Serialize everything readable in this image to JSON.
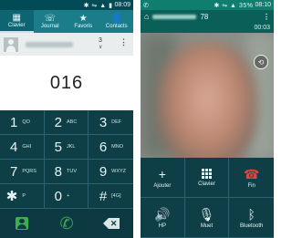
{
  "dialer": {
    "status": {
      "time": "08:09",
      "icons": "✱ ⇋ ▲ ▮"
    },
    "tabs": [
      {
        "label": "Clavier",
        "icon": "keypad-icon",
        "glyph": "▦"
      },
      {
        "label": "Journal",
        "icon": "call-log-icon",
        "glyph": "☏"
      },
      {
        "label": "Favoris",
        "icon": "star-icon",
        "glyph": "★"
      },
      {
        "label": "Contacts",
        "icon": "person-icon",
        "glyph": "👤"
      }
    ],
    "suggestion": {
      "count": "3",
      "chevron": "∨",
      "menu": "⋮"
    },
    "number": "016",
    "keys": [
      {
        "digit": "1",
        "sub": "QO"
      },
      {
        "digit": "2",
        "sub": "ABC"
      },
      {
        "digit": "3",
        "sub": "DEF"
      },
      {
        "digit": "4",
        "sub": "GHI"
      },
      {
        "digit": "5",
        "sub": "JKL"
      },
      {
        "digit": "6",
        "sub": "MNO"
      },
      {
        "digit": "7",
        "sub": "PQRS"
      },
      {
        "digit": "8",
        "sub": "TUV"
      },
      {
        "digit": "9",
        "sub": "WXYZ"
      },
      {
        "digit": "✱",
        "sub": "P"
      },
      {
        "digit": "0",
        "sub": "+"
      },
      {
        "digit": "#",
        "sub": "[4G]"
      }
    ],
    "actions": {
      "contact_icon": "add-contact-icon",
      "call_icon": "phone-icon",
      "call_glyph": "✆",
      "delete_icon": "backspace-icon",
      "delete_glyph": "✕"
    },
    "colors": {
      "accent": "#1b7d8a",
      "call_green": "#3cae50"
    }
  },
  "call": {
    "status": {
      "time": "08:10",
      "signal": "35%",
      "icons": "✱ ⇋ ▲"
    },
    "header": {
      "home_glyph": "⌂",
      "number_suffix": "78",
      "menu": "⋮",
      "timer": "00:03"
    },
    "swap_glyph": "⟲",
    "buttons": [
      {
        "label": "Ajouter",
        "icon": "plus-icon",
        "glyph": "+"
      },
      {
        "label": "Clavier",
        "icon": "keypad-icon",
        "glyph": ""
      },
      {
        "label": "Fin",
        "icon": "end-call-icon",
        "glyph": "☎"
      },
      {
        "label": "HP",
        "icon": "speaker-icon",
        "glyph": "🔊"
      },
      {
        "label": "Muet",
        "icon": "mute-icon",
        "glyph": "🎙"
      },
      {
        "label": "Bluetooth",
        "icon": "bluetooth-icon",
        "glyph": "ᛒ"
      }
    ],
    "colors": {
      "end_red": "#e2453a"
    }
  }
}
